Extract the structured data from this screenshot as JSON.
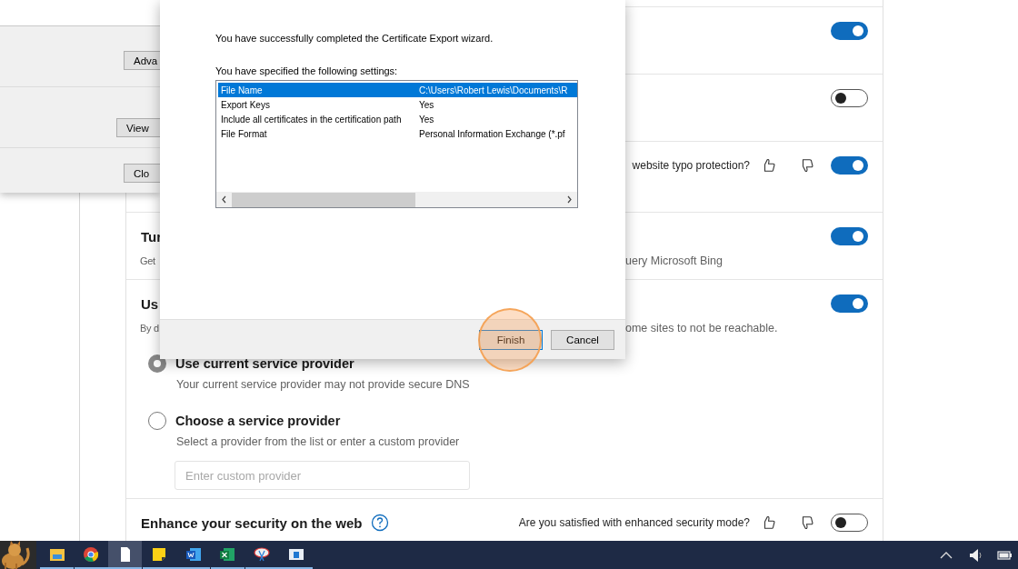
{
  "settings_dialog": {
    "buttons": [
      "Adva",
      "View",
      "Clo"
    ]
  },
  "settings": {
    "rows": [
      {
        "toggle_on": true
      },
      {
        "toggle_on": false
      },
      {
        "question": "website typo protection?",
        "toggle_on": true
      },
      {
        "title": "Tur",
        "description": "Get",
        "description_end": "uery Microsoft Bing",
        "toggle_on": true
      },
      {
        "title": "Us",
        "description": "By d",
        "description_end": "ome sites to not be reachable.",
        "toggle_on": true,
        "options": [
          {
            "label": "Use current service provider",
            "description": "Your current service provider may not provide secure DNS",
            "selected": true
          },
          {
            "label": "Choose a service provider",
            "description": "Select a provider from the list or enter a custom provider",
            "selected": false
          }
        ],
        "custom_provider": {
          "placeholder": "Enter custom provider"
        }
      },
      {
        "title": "Enhance your security on the web",
        "help": true,
        "question": "Are you satisfied with enhanced security mode?",
        "toggle_on": false
      }
    ]
  },
  "wizard": {
    "message": "You have successfully completed the Certificate Export wizard.",
    "settings_label": "You have specified the following settings:",
    "settings": [
      {
        "name": "File Name",
        "value": "C:\\Users\\Robert Lewis\\Documents\\R",
        "selected": true
      },
      {
        "name": "Export Keys",
        "value": "Yes",
        "selected": false
      },
      {
        "name": "Include all certificates in the certification path",
        "value": "Yes",
        "selected": false
      },
      {
        "name": "File Format",
        "value": "Personal Information Exchange (*.pf",
        "selected": false
      }
    ],
    "buttons": [
      {
        "label": "Finish",
        "highlighted": true
      },
      {
        "label": "Cancel",
        "highlighted": false
      }
    ]
  },
  "taskbar": {
    "apps": [
      {
        "kind": "folder",
        "active": false
      },
      {
        "kind": "browser",
        "active": false
      },
      {
        "kind": "document",
        "active": true
      },
      {
        "kind": "sticky-note",
        "active": false
      },
      {
        "kind": "word",
        "active": false
      },
      {
        "kind": "excel",
        "active": false
      },
      {
        "kind": "snipping",
        "active": false
      },
      {
        "kind": "window",
        "active": false
      }
    ]
  }
}
